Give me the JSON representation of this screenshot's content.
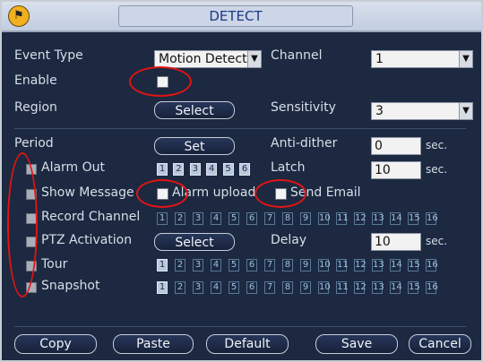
{
  "title": "DETECT",
  "labels": {
    "event_type": "Event Type",
    "enable": "Enable",
    "region": "Region",
    "period": "Period",
    "alarm_out": "Alarm Out",
    "show_message": "Show Message",
    "record_channel": "Record Channel",
    "ptz_activation": "PTZ Activation",
    "tour": "Tour",
    "snapshot": "Snapshot",
    "channel": "Channel",
    "sensitivity": "Sensitivity",
    "anti_dither": "Anti-dither",
    "latch": "Latch",
    "delay": "Delay",
    "alarm_upload": "Alarm upload",
    "send_email": "Send Email"
  },
  "values": {
    "event_type": "Motion Detect",
    "channel": "1",
    "sensitivity": "3",
    "anti_dither": "0",
    "latch": "10",
    "delay": "10",
    "unit_sec": "sec."
  },
  "buttons": {
    "region_select": "Select",
    "period_set": "Set",
    "ptz_select": "Select",
    "copy": "Copy",
    "paste": "Paste",
    "default": "Default",
    "save": "Save",
    "cancel": "Cancel"
  },
  "alarm_outputs": [
    "1",
    "2",
    "3",
    "4",
    "5",
    "6"
  ],
  "channels": [
    "1",
    "2",
    "3",
    "4",
    "5",
    "6",
    "7",
    "8",
    "9",
    "10",
    "11",
    "12",
    "13",
    "14",
    "15",
    "16"
  ],
  "record_selected": [],
  "tour_selected": [
    "1"
  ],
  "snapshot_selected": [
    "1"
  ],
  "colors": {
    "annotation": "#e11414",
    "title_text": "#1a3a8a",
    "background": "#1c2941"
  }
}
